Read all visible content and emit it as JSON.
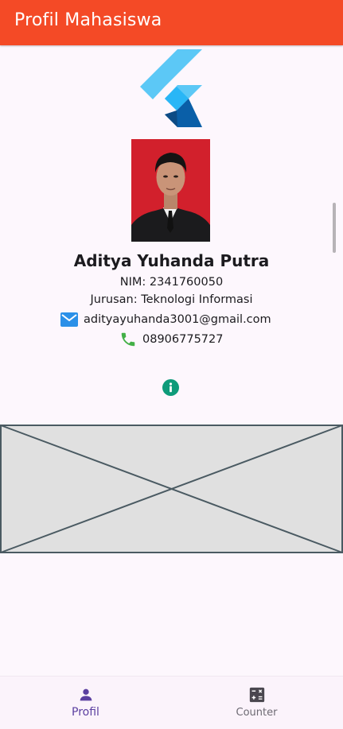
{
  "app_bar": {
    "title": "Profil Mahasiswa",
    "color": "#f44a26"
  },
  "logo": {
    "icon": "flutter-logo-icon"
  },
  "profile": {
    "photo": "profile-photo",
    "name": "Aditya Yuhanda Putra",
    "nim": "NIM: 2341760050",
    "jurusan": "Jurusan: Teknologi Informasi",
    "email": "adityayuhanda3001@gmail.com",
    "phone": "08906775727",
    "email_icon": "email-icon",
    "phone_icon": "phone-icon",
    "info_icon": "info-icon"
  },
  "image_placeholder": {
    "icon": "image-placeholder"
  },
  "bottom_nav": {
    "items": [
      {
        "label": "Profil",
        "icon": "person-icon",
        "active": true,
        "color": "#5b3fa0"
      },
      {
        "label": "Counter",
        "icon": "calculator-icon",
        "active": false,
        "color": "#6d6a73"
      }
    ]
  }
}
